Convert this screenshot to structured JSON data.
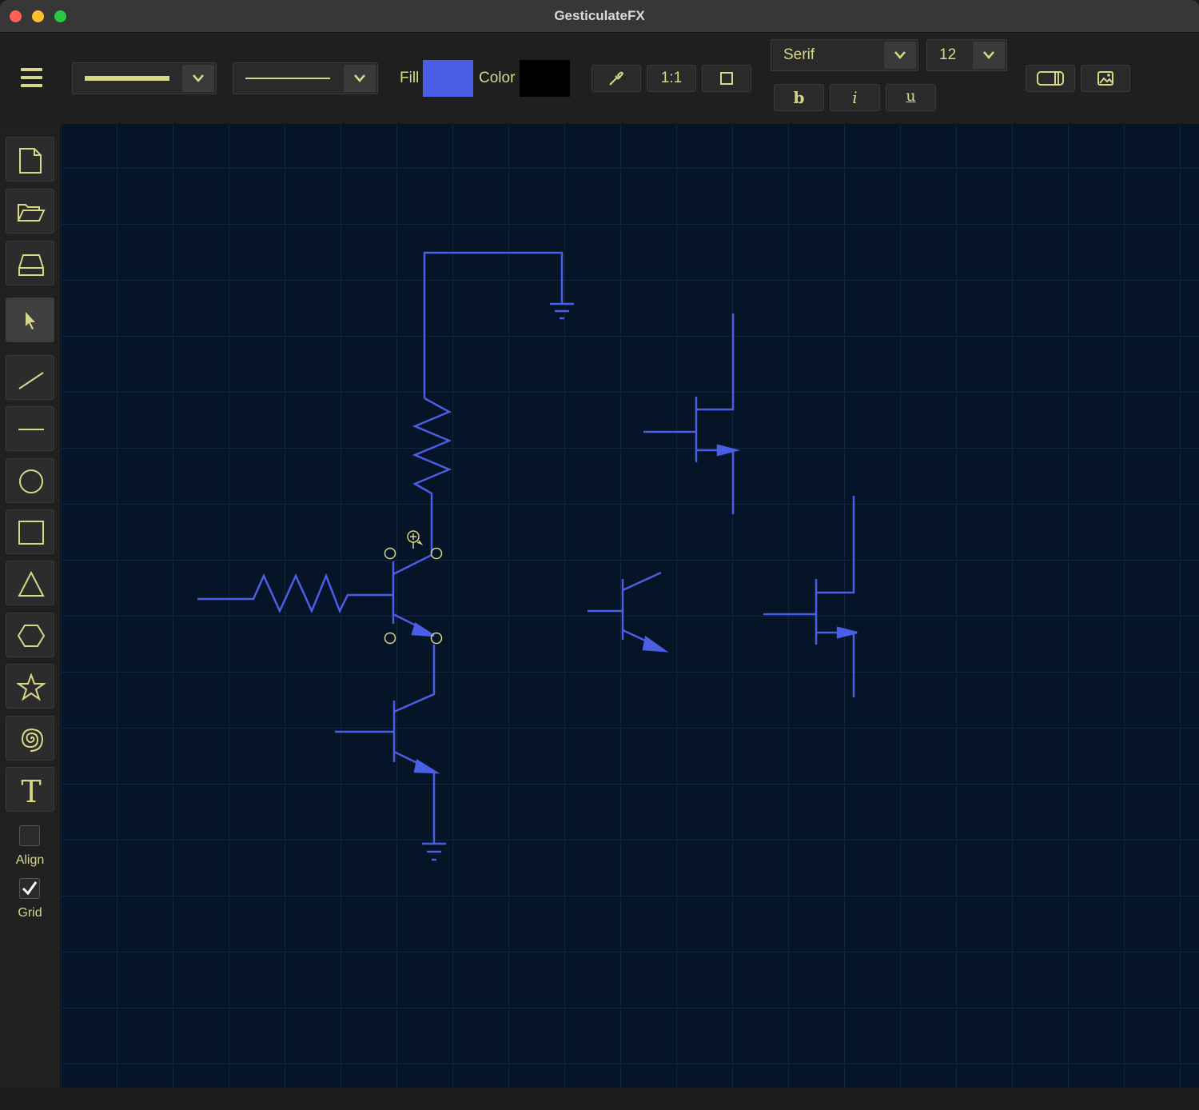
{
  "window": {
    "title": "GesticulateFX"
  },
  "toolbar": {
    "fill_label": "Fill",
    "color_label": "Color",
    "fill_color": "#4a5ee6",
    "stroke_color": "#000000",
    "eyedropper_icon": "eyedropper-icon",
    "zoom_actual_label": "1:1",
    "fit_icon": "square-icon",
    "font_family": "Serif",
    "font_size": "12",
    "bold_label": "b",
    "italic_label": "i",
    "underline_label": "u",
    "panel_icon": "sidebar-toggle-icon",
    "image_icon": "image-icon"
  },
  "sidebar": {
    "tools": [
      "new-document",
      "open-folder",
      "save-drive",
      "select",
      "line",
      "horizontal-line",
      "circle",
      "rectangle",
      "triangle",
      "hexagon",
      "star",
      "spiral",
      "text"
    ],
    "align_label": "Align",
    "grid_label": "Grid",
    "align_checked": false,
    "grid_checked": true
  },
  "canvas": {
    "stroke_color": "#4a5ee6",
    "grid": true,
    "objects": [
      "resistor",
      "resistor",
      "npn-transistor",
      "npn-transistor",
      "npn-transistor",
      "ground",
      "ground",
      "mosfet",
      "mosfet"
    ]
  }
}
